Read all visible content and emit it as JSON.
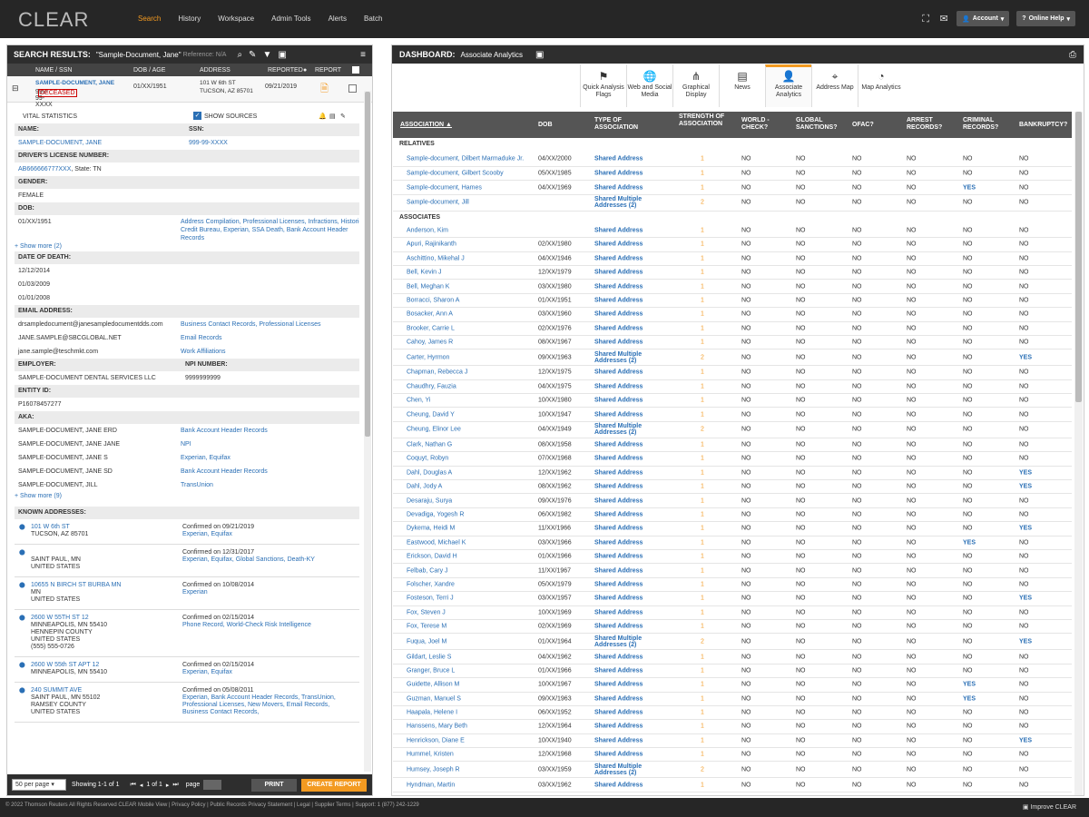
{
  "app": {
    "logo": "CLEAR",
    "nav": [
      "Search",
      "History",
      "Workspace",
      "Admin Tools",
      "Alerts",
      "Batch"
    ],
    "account_label": "Account",
    "help_label": "Online Help"
  },
  "left": {
    "title": "SEARCH RESULTS:",
    "query": "\"Sample-Document, Jane\"",
    "reference": "Reference: N/A",
    "columns": [
      "NAME / SSN",
      "DOB / AGE",
      "ADDRESS",
      "REPORTED",
      "REPORT"
    ],
    "result": {
      "name": "SAMPLE-DOCUMENT, JANE",
      "ssn": "999-99-XXXX",
      "badge": "DECEASED",
      "dob": "01/XX/1951",
      "address1": "101 W 6th ST",
      "address2": "TUCSON, AZ 85701",
      "reported": "09/21/2019"
    },
    "vital_title": "VITAL STATISTICS",
    "show_sources": "SHOW SOURCES",
    "sections": {
      "name_label": "NAME:",
      "ssn_label": "SSN:",
      "name_val": "SAMPLE-DOCUMENT, JANE",
      "ssn_val": "999-99-XXXX",
      "dl_label": "DRIVER'S LICENSE NUMBER:",
      "dl_val": "AB666666777XXX",
      "dl_state": ", State: TN",
      "gender_label": "GENDER:",
      "gender_val": "FEMALE",
      "dob_label": "DOB:",
      "dob_val": "01/XX/1951",
      "dob_src": "Address Compilation, Professional Licenses, Infractions, Historic Credit Bureau, Experian, SSA Death, Bank Account Header Records",
      "show_more_dob": "+ Show more (2)",
      "dod_label": "DATE OF DEATH:",
      "dod": [
        "12/12/2014",
        "01/03/2009",
        "01/01/2008"
      ],
      "email_label": "EMAIL ADDRESS:",
      "emails": [
        {
          "email": "drsampledocument@janesampledocumentdds.com",
          "src": "Business Contact Records, Professional Licenses"
        },
        {
          "email": "JANE.SAMPLE@SBCGLOBAL.NET",
          "src": "Email Records"
        },
        {
          "email": "jane.sample@teschmkt.com",
          "src": "Work Affiliations"
        }
      ],
      "employer_label": "EMPLOYER:",
      "npi_label": "NPI NUMBER:",
      "employer_val": "SAMPLE-DOCUMENT DENTAL SERVICES LLC",
      "npi_val": "9999999999",
      "entity_label": "ENTITY ID:",
      "entity_val": "P16078457277",
      "aka_label": "AKA:",
      "aka": [
        {
          "name": "SAMPLE-DOCUMENT, JANE ERD",
          "src": "Bank Account Header Records"
        },
        {
          "name": "SAMPLE-DOCUMENT, JANE JANE",
          "src": "NPI"
        },
        {
          "name": "SAMPLE-DOCUMENT, JANE S",
          "src": "Experian, Equifax"
        },
        {
          "name": "SAMPLE-DOCUMENT, JANE SD",
          "src": "Bank Account Header Records"
        },
        {
          "name": "SAMPLE-DOCUMENT, JILL",
          "src": "TransUnion"
        }
      ],
      "show_more_aka": "+ Show more (9)",
      "known_label": "KNOWN ADDRESSES:",
      "addresses": [
        {
          "lines": [
            "101 W 6th ST",
            "TUCSON, AZ 85701"
          ],
          "link": true,
          "confirmed": "Confirmed on 09/21/2019",
          "src": "Experian, Equifax"
        },
        {
          "lines": [
            "",
            "SAINT PAUL, MN",
            "UNITED STATES"
          ],
          "link": false,
          "confirmed": "Confirmed on 12/31/2017",
          "src": "Experian, Equifax, Global Sanctions, Death-KY"
        },
        {
          "lines": [
            "10655 N BIRCH ST BURBA MN",
            "MN",
            "UNITED STATES"
          ],
          "link": true,
          "confirmed": "Confirmed on 10/08/2014",
          "src": "Experian"
        },
        {
          "lines": [
            "2600 W 55TH ST 12",
            "MINNEAPOLIS, MN 55410",
            "HENNEPIN COUNTY",
            "UNITED STATES",
            "(555) 555-0726"
          ],
          "link": true,
          "confirmed": "Confirmed on 02/15/2014",
          "src": "Phone Record, World-Check Risk Intelligence"
        },
        {
          "lines": [
            "2600 W 55th ST APT 12",
            "MINNEAPOLIS, MN 55410"
          ],
          "link": true,
          "confirmed": "Confirmed on 02/15/2014",
          "src": "Experian, Equifax"
        },
        {
          "lines": [
            "240 SUMMIT AVE",
            "SAINT PAUL, MN 55102",
            "RAMSEY COUNTY",
            "UNITED STATES"
          ],
          "link": true,
          "confirmed": "Confirmed on 05/08/2011",
          "src": "Experian, Bank Account Header Records, TransUnion, Professional Licenses, New Movers, Email Records, Business Contact Records,"
        }
      ]
    },
    "footer": {
      "per_page": "50 per page",
      "showing": "Showing  1-1 of 1",
      "pager": "1 of 1",
      "page_label": "page",
      "print": "PRINT",
      "create": "CREATE REPORT"
    }
  },
  "right": {
    "title": "DASHBOARD:",
    "subtitle": "Associate Analytics",
    "tabs": [
      {
        "label": "Quick Analysis Flags",
        "icon": "⚑"
      },
      {
        "label": "Web and Social Media",
        "icon": "🌐"
      },
      {
        "label": "Graphical Display",
        "icon": "⋔"
      },
      {
        "label": "News",
        "icon": "▤"
      },
      {
        "label": "Associate Analytics",
        "icon": "👤"
      },
      {
        "label": "Address Map",
        "icon": "⌖"
      },
      {
        "label": "Map Analytics",
        "icon": "◔"
      }
    ],
    "headers": [
      "ASSOCIATION ▲",
      "DOB",
      "TYPE OF ASSOCIATION",
      "STRENGTH OF ASSOCIATION",
      "WORLD - CHECK?",
      "GLOBAL SANCTIONS?",
      "OFAC?",
      "ARREST RECORDS?",
      "CRIMINAL RECORDS?",
      "BANKRUPTCY?"
    ],
    "relatives_label": "RELATIVES",
    "associates_label": "ASSOCIATES",
    "relatives": [
      [
        "Sample-document, Dilbert Marmaduke Jr.",
        "04/XX/2000",
        "Shared Address",
        "1",
        "NO",
        "NO",
        "NO",
        "NO",
        "NO",
        "NO"
      ],
      [
        "Sample-document, Gilbert Scooby",
        "05/XX/1985",
        "Shared Address",
        "1",
        "NO",
        "NO",
        "NO",
        "NO",
        "NO",
        "NO"
      ],
      [
        "Sample-document, Hames",
        "04/XX/1969",
        "Shared Address",
        "1",
        "NO",
        "NO",
        "NO",
        "NO",
        "YES",
        "NO"
      ],
      [
        "Sample-document, Jill",
        "",
        "Shared Multiple Addresses (2)",
        "2",
        "NO",
        "NO",
        "NO",
        "NO",
        "NO",
        "NO"
      ]
    ],
    "associates": [
      [
        "Anderson, Kim",
        "",
        "Shared Address",
        "1",
        "NO",
        "NO",
        "NO",
        "NO",
        "NO",
        "NO"
      ],
      [
        "Apuri, Rajinikanth",
        "02/XX/1980",
        "Shared Address",
        "1",
        "NO",
        "NO",
        "NO",
        "NO",
        "NO",
        "NO"
      ],
      [
        "Aschittino, Mikehal J",
        "04/XX/1946",
        "Shared Address",
        "1",
        "NO",
        "NO",
        "NO",
        "NO",
        "NO",
        "NO"
      ],
      [
        "Bell, Kevin J",
        "12/XX/1979",
        "Shared Address",
        "1",
        "NO",
        "NO",
        "NO",
        "NO",
        "NO",
        "NO"
      ],
      [
        "Bell, Meghan K",
        "03/XX/1980",
        "Shared Address",
        "1",
        "NO",
        "NO",
        "NO",
        "NO",
        "NO",
        "NO"
      ],
      [
        "Borracci, Sharon A",
        "01/XX/1951",
        "Shared Address",
        "1",
        "NO",
        "NO",
        "NO",
        "NO",
        "NO",
        "NO"
      ],
      [
        "Bosacker, Ann A",
        "03/XX/1960",
        "Shared Address",
        "1",
        "NO",
        "NO",
        "NO",
        "NO",
        "NO",
        "NO"
      ],
      [
        "Brooker, Carrie L",
        "02/XX/1976",
        "Shared Address",
        "1",
        "NO",
        "NO",
        "NO",
        "NO",
        "NO",
        "NO"
      ],
      [
        "Cahoy, James R",
        "08/XX/1967",
        "Shared Address",
        "1",
        "NO",
        "NO",
        "NO",
        "NO",
        "NO",
        "NO"
      ],
      [
        "Carter, Hyrmon",
        "09/XX/1963",
        "Shared Multiple Addresses (2)",
        "2",
        "NO",
        "NO",
        "NO",
        "NO",
        "NO",
        "YES"
      ],
      [
        "Chapman, Rebecca J",
        "12/XX/1975",
        "Shared Address",
        "1",
        "NO",
        "NO",
        "NO",
        "NO",
        "NO",
        "NO"
      ],
      [
        "Chaudhry, Fauzia",
        "04/XX/1975",
        "Shared Address",
        "1",
        "NO",
        "NO",
        "NO",
        "NO",
        "NO",
        "NO"
      ],
      [
        "Chen, Yi",
        "10/XX/1980",
        "Shared Address",
        "1",
        "NO",
        "NO",
        "NO",
        "NO",
        "NO",
        "NO"
      ],
      [
        "Cheung, David Y",
        "10/XX/1947",
        "Shared Address",
        "1",
        "NO",
        "NO",
        "NO",
        "NO",
        "NO",
        "NO"
      ],
      [
        "Cheung, Elinor Lee",
        "04/XX/1949",
        "Shared Multiple Addresses (2)",
        "2",
        "NO",
        "NO",
        "NO",
        "NO",
        "NO",
        "NO"
      ],
      [
        "Clark, Nathan G",
        "08/XX/1958",
        "Shared Address",
        "1",
        "NO",
        "NO",
        "NO",
        "NO",
        "NO",
        "NO"
      ],
      [
        "Coquyt, Robyn",
        "07/XX/1968",
        "Shared Address",
        "1",
        "NO",
        "NO",
        "NO",
        "NO",
        "NO",
        "NO"
      ],
      [
        "Dahl, Douglas A",
        "12/XX/1962",
        "Shared Address",
        "1",
        "NO",
        "NO",
        "NO",
        "NO",
        "NO",
        "YES"
      ],
      [
        "Dahl, Jody A",
        "08/XX/1962",
        "Shared Address",
        "1",
        "NO",
        "NO",
        "NO",
        "NO",
        "NO",
        "YES"
      ],
      [
        "Desaraju, Surya",
        "09/XX/1976",
        "Shared Address",
        "1",
        "NO",
        "NO",
        "NO",
        "NO",
        "NO",
        "NO"
      ],
      [
        "Devadiga, Yogesh R",
        "06/XX/1982",
        "Shared Address",
        "1",
        "NO",
        "NO",
        "NO",
        "NO",
        "NO",
        "NO"
      ],
      [
        "Dykema, Heidi M",
        "11/XX/1966",
        "Shared Address",
        "1",
        "NO",
        "NO",
        "NO",
        "NO",
        "NO",
        "YES"
      ],
      [
        "Eastwood, Michael K",
        "03/XX/1966",
        "Shared Address",
        "1",
        "NO",
        "NO",
        "NO",
        "NO",
        "YES",
        "NO"
      ],
      [
        "Erickson, David H",
        "01/XX/1966",
        "Shared Address",
        "1",
        "NO",
        "NO",
        "NO",
        "NO",
        "NO",
        "NO"
      ],
      [
        "Felbab, Cary J",
        "11/XX/1967",
        "Shared Address",
        "1",
        "NO",
        "NO",
        "NO",
        "NO",
        "NO",
        "NO"
      ],
      [
        "Folscher, Xandre",
        "05/XX/1979",
        "Shared Address",
        "1",
        "NO",
        "NO",
        "NO",
        "NO",
        "NO",
        "NO"
      ],
      [
        "Fosteson, Terri J",
        "03/XX/1957",
        "Shared Address",
        "1",
        "NO",
        "NO",
        "NO",
        "NO",
        "NO",
        "YES"
      ],
      [
        "Fox, Steven J",
        "10/XX/1969",
        "Shared Address",
        "1",
        "NO",
        "NO",
        "NO",
        "NO",
        "NO",
        "NO"
      ],
      [
        "Fox, Terese M",
        "02/XX/1969",
        "Shared Address",
        "1",
        "NO",
        "NO",
        "NO",
        "NO",
        "NO",
        "NO"
      ],
      [
        "Fuqua, Joel M",
        "01/XX/1964",
        "Shared Multiple Addresses (2)",
        "2",
        "NO",
        "NO",
        "NO",
        "NO",
        "NO",
        "YES"
      ],
      [
        "Gildart, Leslie S",
        "04/XX/1962",
        "Shared Address",
        "1",
        "NO",
        "NO",
        "NO",
        "NO",
        "NO",
        "NO"
      ],
      [
        "Granger, Bruce L",
        "01/XX/1966",
        "Shared Address",
        "1",
        "NO",
        "NO",
        "NO",
        "NO",
        "NO",
        "NO"
      ],
      [
        "Guidette, Allison M",
        "10/XX/1967",
        "Shared Address",
        "1",
        "NO",
        "NO",
        "NO",
        "NO",
        "YES",
        "NO"
      ],
      [
        "Guzman, Manuel S",
        "09/XX/1963",
        "Shared Address",
        "1",
        "NO",
        "NO",
        "NO",
        "NO",
        "YES",
        "NO"
      ],
      [
        "Haapala, Helene I",
        "06/XX/1952",
        "Shared Address",
        "1",
        "NO",
        "NO",
        "NO",
        "NO",
        "NO",
        "NO"
      ],
      [
        "Hanssens, Mary Beth",
        "12/XX/1964",
        "Shared Address",
        "1",
        "NO",
        "NO",
        "NO",
        "NO",
        "NO",
        "NO"
      ],
      [
        "Henrickson, Diane E",
        "10/XX/1940",
        "Shared Address",
        "1",
        "NO",
        "NO",
        "NO",
        "NO",
        "NO",
        "YES"
      ],
      [
        "Hummel, Kristen",
        "12/XX/1968",
        "Shared Address",
        "1",
        "NO",
        "NO",
        "NO",
        "NO",
        "NO",
        "NO"
      ],
      [
        "Humsey, Joseph R",
        "03/XX/1959",
        "Shared Multiple Addresses (2)",
        "2",
        "NO",
        "NO",
        "NO",
        "NO",
        "NO",
        "NO"
      ],
      [
        "Hyndman, Martin",
        "03/XX/1962",
        "Shared Address",
        "1",
        "NO",
        "NO",
        "NO",
        "NO",
        "NO",
        "NO"
      ]
    ]
  },
  "footer": {
    "text": "© 2022 Thomson Reuters  All Rights Reserved  CLEAR Mobile View  |  Privacy Policy  |  Public Records Privacy Statement  |  Legal  |  Supplier Terms  |  Support: 1 (877) 242-1229",
    "improve": "Improve CLEAR"
  }
}
